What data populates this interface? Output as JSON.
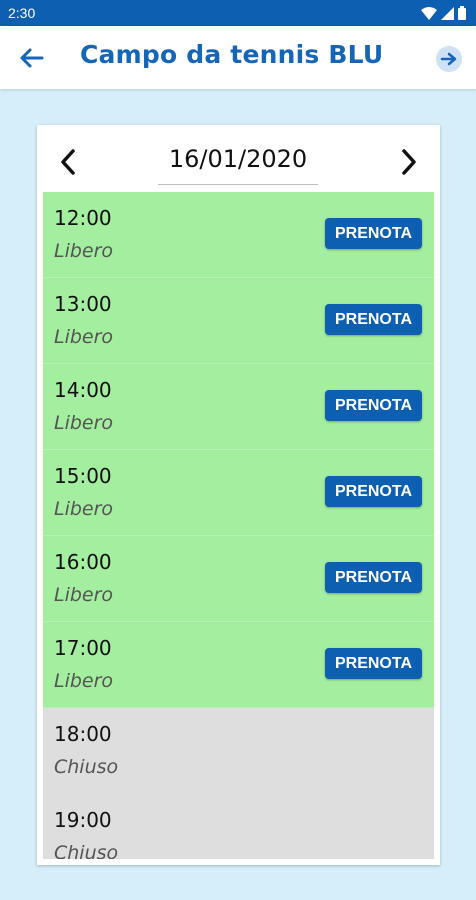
{
  "status_bar": {
    "time": "2:30"
  },
  "header": {
    "title": "Campo da tennis BLU"
  },
  "date_picker": {
    "date": "16/01/2020"
  },
  "slots": [
    {
      "time": "12:00",
      "status": "Libero",
      "available": true,
      "button_label": "PRENOTA"
    },
    {
      "time": "13:00",
      "status": "Libero",
      "available": true,
      "button_label": "PRENOTA"
    },
    {
      "time": "14:00",
      "status": "Libero",
      "available": true,
      "button_label": "PRENOTA"
    },
    {
      "time": "15:00",
      "status": "Libero",
      "available": true,
      "button_label": "PRENOTA"
    },
    {
      "time": "16:00",
      "status": "Libero",
      "available": true,
      "button_label": "PRENOTA"
    },
    {
      "time": "17:00",
      "status": "Libero",
      "available": true,
      "button_label": "PRENOTA"
    },
    {
      "time": "18:00",
      "status": "Chiuso",
      "available": false
    },
    {
      "time": "19:00",
      "status": "Chiuso",
      "available": false
    }
  ],
  "colors": {
    "primary": "#0d5fb1",
    "title": "#1565b8",
    "page_background": "#d6eefa",
    "slot_free": "#a3ee9f",
    "slot_closed": "#dedede"
  },
  "icons": {
    "back": "arrow-left-icon",
    "logout": "exit-arrow-icon",
    "prev": "chevron-left-icon",
    "next": "chevron-right-icon",
    "wifi": "wifi-icon",
    "signal": "signal-icon",
    "battery": "battery-icon"
  }
}
